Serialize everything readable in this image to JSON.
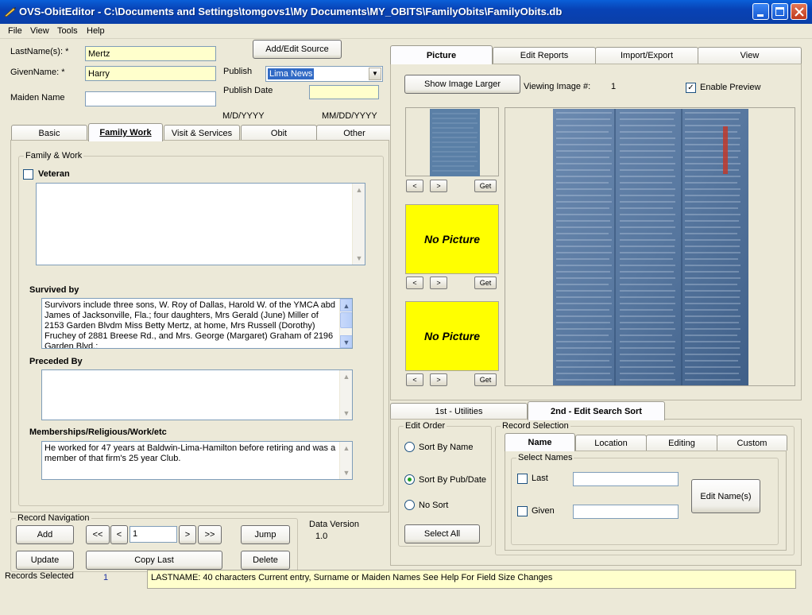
{
  "window": {
    "title": "OVS-ObitEditor - C:\\Documents and Settings\\tomgovs1\\My Documents\\MY_OBITS\\FamilyObits\\FamilyObits.db"
  },
  "menu": [
    "File",
    "View",
    "Tools",
    "Help"
  ],
  "form": {
    "lastname_label": "LastName(s): *",
    "lastname_value": "Mertz",
    "givenname_label": "GivenName: *",
    "givenname_value": "Harry",
    "maiden_label": "Maiden Name",
    "maiden_value": "",
    "add_source_button": "Add/Edit Source",
    "publish_label": "Publish",
    "publish_value": "Lima News",
    "publish_date_label": "Publish Date",
    "publish_date_value": "",
    "date_format_1": "M/D/YYYY",
    "date_format_2": "MM/DD/YYYY"
  },
  "left_tabs": [
    "Basic",
    "Family Work",
    "Visit & Services",
    "Obit",
    "Other"
  ],
  "family_work": {
    "group_title": "Family & Work",
    "veteran_label": "Veteran",
    "veteran_checked": false,
    "veteran_text": "",
    "survived_label": "Survived by",
    "survived_text": "Survivors include three sons, W. Roy of Dallas, Harold W. of the YMCA abd James of Jacksonville, Fla.; four daughters, Mrs Gerald (June) Miller of 2153 Garden Blvdm Miss Betty Mertz, at home, Mrs Russell (Dorothy) Fruchey of 2881 Breese Rd., and Mrs. George (Margaret) Graham of 2196 Garden Blvd.;",
    "preceded_label": "Preceded By",
    "preceded_text": "",
    "memberships_label": "Memberships/Religious/Work/etc",
    "memberships_text": "He worked  for 47 years at Baldwin-Lima-Hamilton before retiring and was a member of that firm's 25 year Club."
  },
  "record_nav": {
    "title": "Record Navigation",
    "add": "Add",
    "first": "<<",
    "prev": "<",
    "record_value": "1",
    "next": ">",
    "last": ">>",
    "jump": "Jump",
    "update": "Update",
    "copy_last": "Copy Last",
    "delete": "Delete"
  },
  "data_version": {
    "label": "Data Version",
    "value": "1.0"
  },
  "status": {
    "records_label": "Records Selected",
    "records_value": "1",
    "message": "LASTNAME: 40 characters Current entry, Surname or Maiden Names See Help For Field Size Changes"
  },
  "right_tabs": [
    "Picture",
    "Edit Reports",
    "Import/Export",
    "View"
  ],
  "picture": {
    "show_larger": "Show Image Larger",
    "viewing_label": "Viewing Image #:",
    "viewing_value": "1",
    "enable_preview_label": "Enable Preview",
    "enable_preview_checked": true,
    "no_picture": "No Picture",
    "get": "Get",
    "prev_arrow": "<",
    "next_arrow": ">"
  },
  "bottom_tabs": [
    "1st - Utilities",
    "2nd - Edit Search Sort"
  ],
  "edit_order": {
    "title": "Edit Order",
    "options": [
      "Sort By Name",
      "Sort By Pub/Date",
      "No Sort"
    ],
    "selected": "Sort By Pub/Date",
    "select_all": "Select All"
  },
  "record_selection": {
    "title": "Record Selection",
    "tabs": [
      "Name",
      "Location",
      "Editing",
      "Custom"
    ],
    "select_names_title": "Select Names",
    "last_label": "Last",
    "given_label": "Given",
    "last_value": "",
    "given_value": "",
    "edit_names_button": "Edit Name(s)"
  },
  "colors": {
    "accent": "#0a5fd8",
    "field_yellow": "#ffffcc",
    "nopic_yellow": "#ffff00"
  }
}
